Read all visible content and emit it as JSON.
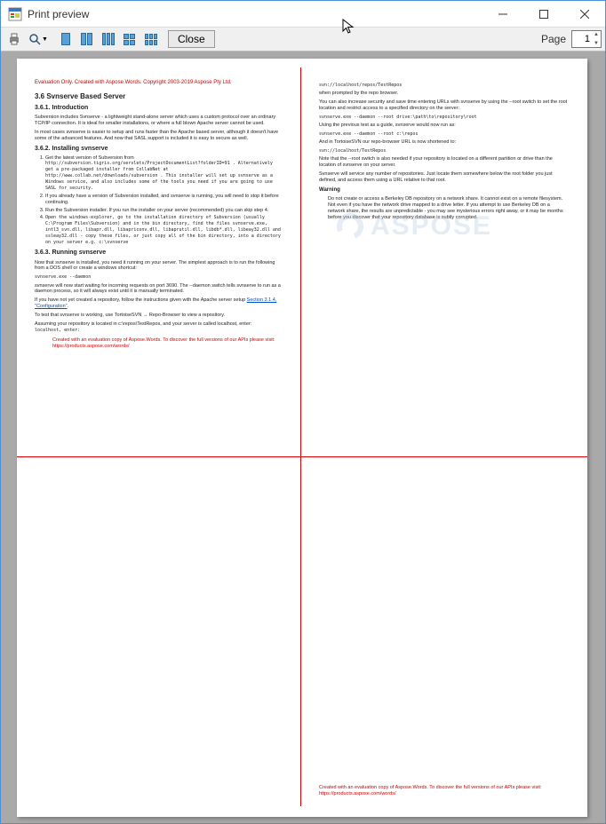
{
  "window": {
    "title": "Print preview"
  },
  "toolbar": {
    "close_label": "Close",
    "page_label": "Page",
    "page_value": "1"
  },
  "doc_left": {
    "eval_header": "Evaluation Only. Created with Aspose.Words. Copyright 2003-2019 Aspose Pty Ltd.",
    "h1": "3.6 Svnserve Based Server",
    "h2a": "3.6.1. Introduction",
    "p1": "Subversion includes Svnserve - a lightweight stand-alone server which uses a custom protocol over an ordinary TCP/IP connection. It is ideal for smaller installations, or where a full blown Apache server cannot be used.",
    "p2": "In most cases svnserve is easier to setup and runs faster than the Apache based server, although it doesn't have some of the advanced features. And now that SASL support is included it is easy to secure as well.",
    "h2b": "3.6.2. Installing svnserve",
    "step1": "Get the latest version of Subversion from",
    "step1a": "http://subversion.tigris.org/servlets/ProjectDocumentList?folderID=91 . Alternatively get a pre-packaged installer from CollabNet at",
    "step1b": "http://www.collab.net/downloads/subversion . This installer will set up svnserve as a Windows service, and also includes some of the tools you need if you are going to use SASL for security.",
    "step2": "If you already have a version of Subversion installed, and svnserve is running, you will need to stop it before continuing.",
    "step3": "Run the Subversion installer. If you run the installer on your server (recommended) you can skip step 4.",
    "step4": "Open the windows-explorer, go to the installation directory of Subversion (usually C:\\Program Files\\Subversion) and in the bin directory, find the files svnserve.exe, intl3_svn.dll, libapr.dll, libapriconv.dll, libaprutil.dll, libdb*.dll, libeay32.dll and ssleay32.dll - copy these files, or just copy all of the bin directory, into a directory on your server e.g. c:\\svnserve",
    "h2c": "3.6.3. Running svnserve",
    "p3": "Now that svnserve is installed, you need it running on your server. The simplest approach is to run the following from a DOS shell or create a windows shortcut:",
    "cmd1": "svnserve.exe --daemon",
    "p4": "svnserve will now start waiting for incoming requests on port 3690. The --daemon switch tells svnserve to run as a daemon process, so it will always exist until it is manually terminated.",
    "p5a": "If you have not yet created a repository, follow the instructions given with the Apache server setup ",
    "p5b": "Section 3.1.4, \"Configuration\"",
    "p5c": ".",
    "p6": "To test that svnserve is working, use TortoiseSVN → Repo-Browser to view a repository.",
    "p7": "Assuming your repository is located in c:\\repos\\TestRepos, and your server is called localhost, enter:",
    "footer": "Created with an evaluation copy of Aspose.Words. To discover the full versions of our APIs please visit: https://products.aspose.com/words/"
  },
  "doc_right": {
    "cmd1": "svn://localhost/repos/TestRepos",
    "p1": "when prompted by the repo browser.",
    "p2": "You can also increase security and save time entering URLs with svnserve by using the --root switch to set the root location and restrict access to a specified directory on the server:",
    "cmd2": "svnserve.exe --daemon --root drive:\\path\\to\\repository\\root",
    "p3": "Using the previous test as a guide, svnserve would now run as:",
    "cmd3": "svnserve.exe --daemon --root c:\\repos",
    "p4": "And in TortoiseSVN our repo-browser URL is now shortened to:",
    "cmd4": "svn://localhost/TestRepos",
    "p5": "Note that the --root switch is also needed if your repository is located on a different partition or drive than the location of svnserve on your server.",
    "p6": "Svnserve will service any number of repositories. Just locate them somewhere below the root folder you just defined, and access them using a URL relative to that root.",
    "warn_title": "Warning",
    "warn_body": "Do not create or access a Berkeley DB repository on a network share. It cannot exist on a remote filesystem. Not even if you have the network drive mapped to a drive letter. If you attempt to use Berkeley DB on a network share, the results are unpredictable - you may see mysterious errors right away, or it may be months before you discover that your repository database is subtly corrupted.",
    "footer": "Created with an evaluation copy of Aspose.Words. To discover the full versions of our APIs please visit: https://products.aspose.com/words/",
    "watermark": "ASPOSE"
  }
}
